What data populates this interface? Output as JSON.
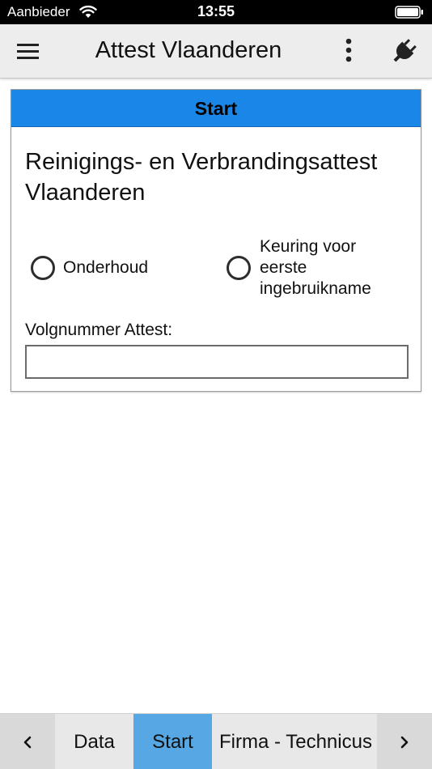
{
  "status_bar": {
    "carrier": "Aanbieder",
    "time": "13:55",
    "icons": [
      "wifi-icon",
      "battery-icon"
    ]
  },
  "app_bar": {
    "title": "Attest Vlaanderen",
    "icons": [
      "hamburger-menu-icon",
      "more-vertical-icon",
      "plug-icon"
    ]
  },
  "card": {
    "header": "Start",
    "heading": "Reinigings- en Verbrandingsattest Vlaanderen",
    "options": [
      {
        "label": "Onderhoud",
        "selected": false
      },
      {
        "label": "Keuring voor eerste ingebruikname",
        "selected": false
      }
    ],
    "field": {
      "label": "Volgnummer Attest:",
      "value": "",
      "placeholder": ""
    }
  },
  "bottom_tabs": {
    "items": [
      {
        "label": "Data",
        "active": false
      },
      {
        "label": "Start",
        "active": true
      },
      {
        "label": "Firma - Technicus",
        "active": false
      }
    ],
    "icons": [
      "chevron-left-icon",
      "chevron-right-icon"
    ]
  },
  "colors": {
    "header_blue": "#1a86e8",
    "active_tab": "#56a7e4",
    "app_bar": "#ededed"
  }
}
